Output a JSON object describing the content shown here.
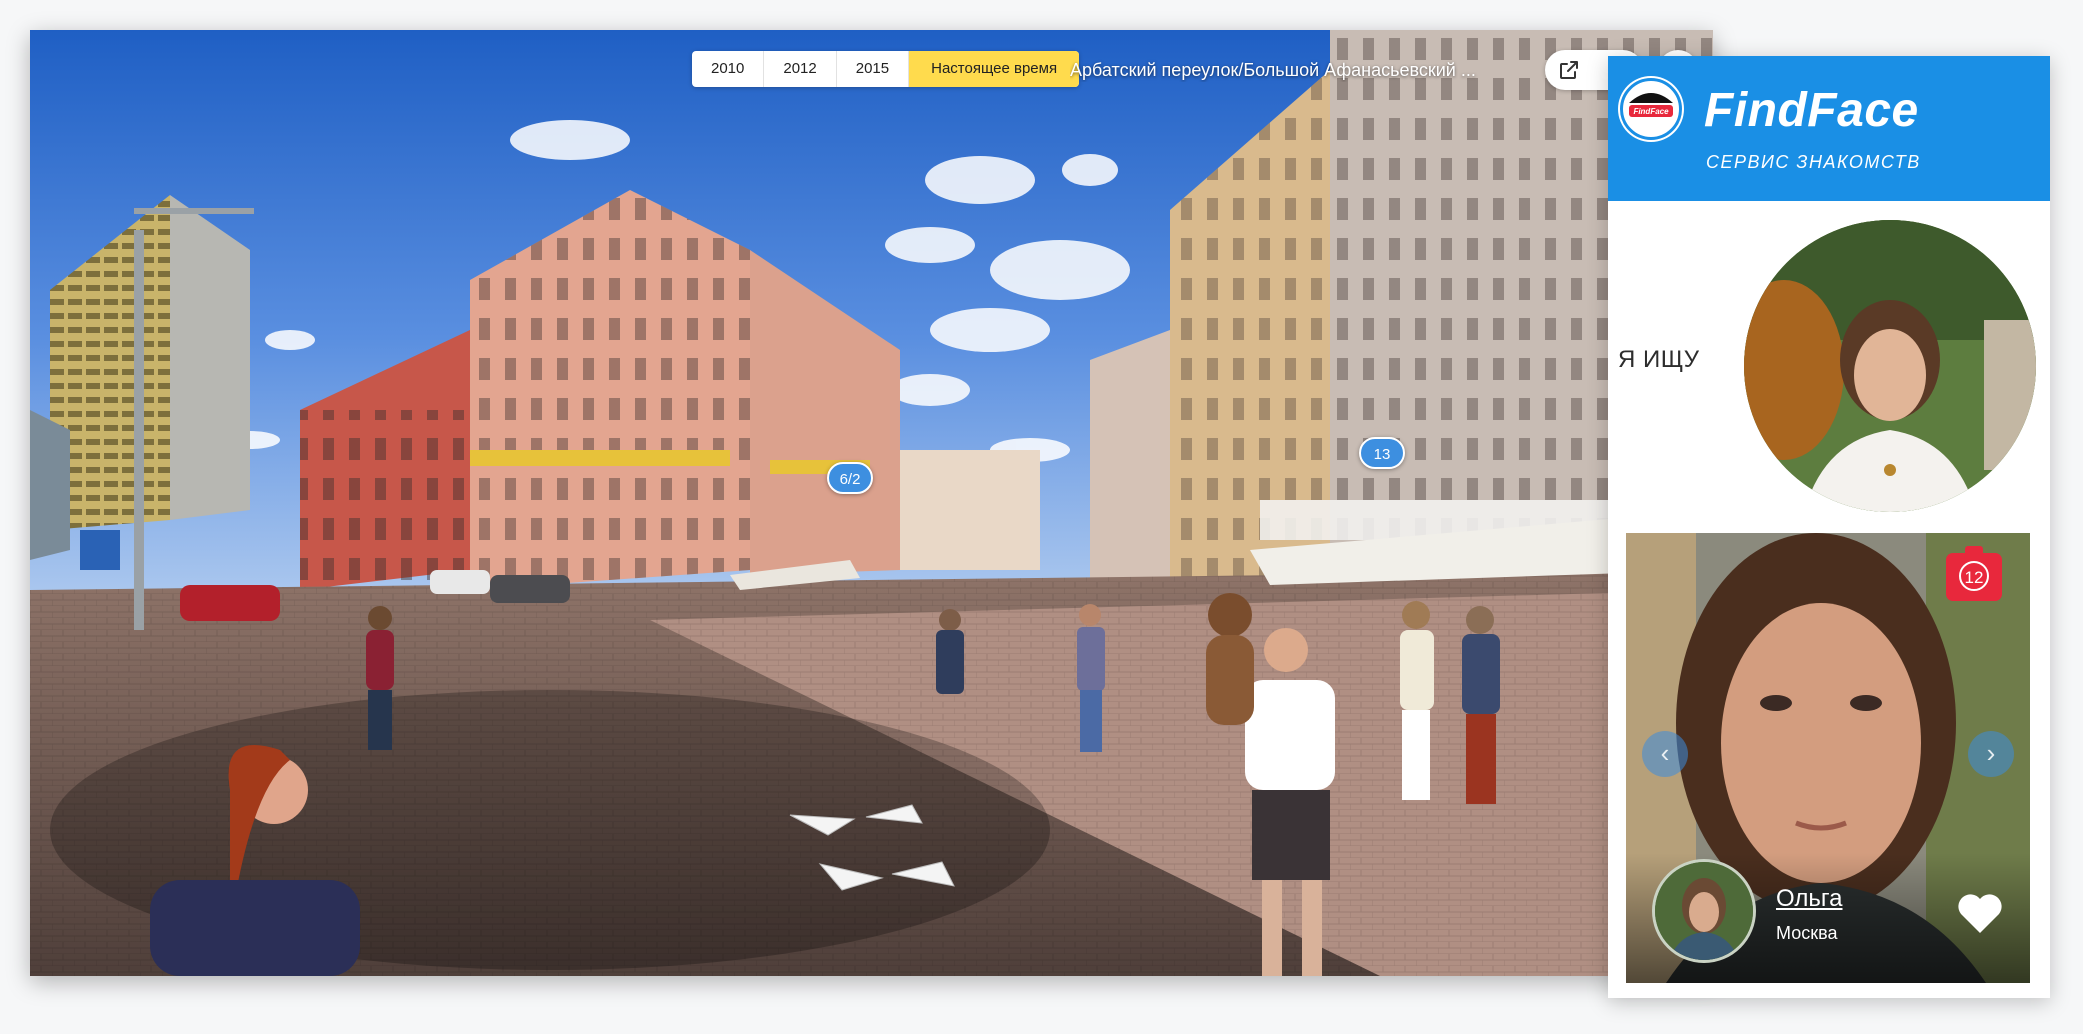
{
  "viewer": {
    "years": [
      {
        "label": "2010",
        "active": false
      },
      {
        "label": "2012",
        "active": false
      },
      {
        "label": "2015",
        "active": false
      },
      {
        "label": "Настоящее время",
        "active": true
      }
    ],
    "address": "Арбатский переулок/Большой Афанасьевский ...",
    "house_badges": [
      "6/2",
      "13"
    ],
    "accent_color": "#ffdb4d",
    "badge_color": "#3d8fe0",
    "share_icon": "external-link-icon"
  },
  "findface": {
    "brand": "FindFace",
    "logo_text": "FindFace",
    "tagline": "СЕРВИС ЗНАКОМСТВ",
    "search_label": "Я ИЩУ",
    "header_color": "#1a8fe5",
    "result": {
      "photo_count": "12",
      "name": "Ольга",
      "city": "Москва",
      "like_icon": "heart-icon"
    }
  }
}
